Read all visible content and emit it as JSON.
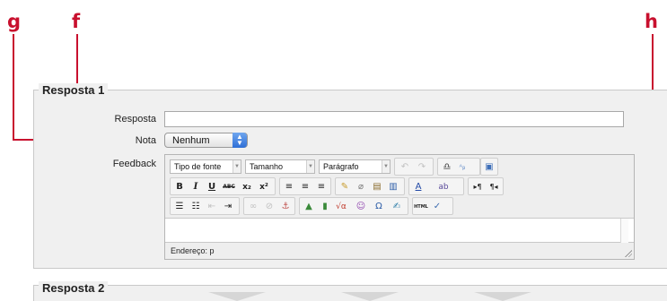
{
  "callouts": {
    "g": "g",
    "f": "f",
    "h": "h"
  },
  "accent_color": "#c8102e",
  "section1": {
    "legend": "Resposta 1",
    "resposta_label": "Resposta",
    "resposta_value": "",
    "nota_label": "Nota",
    "nota_value": "Nenhum",
    "feedback_label": "Feedback"
  },
  "editor": {
    "font_family_select": "Tipo de fonte",
    "font_size_select": "Tamanho",
    "paragraph_select": "Parágrafo",
    "status_path": "Endereço: p",
    "row1_icons": [
      "undo-icon",
      "redo-icon",
      "find-icon",
      "replace-icon",
      "fullscreen-icon"
    ],
    "row2_icons": [
      "bold-icon",
      "italic-icon",
      "underline-icon",
      "strikethrough-icon",
      "subscript-icon",
      "superscript-icon",
      "align-left-icon",
      "align-center-icon",
      "align-right-icon",
      "cleanup-icon",
      "remove-format-icon",
      "paste-text-icon",
      "paste-word-icon",
      "text-color-icon",
      "background-color-icon",
      "ltr-icon",
      "rtl-icon"
    ],
    "row3_icons": [
      "unordered-list-icon",
      "ordered-list-icon",
      "outdent-icon",
      "indent-icon",
      "link-icon",
      "unlink-icon",
      "anchor-icon",
      "image-icon",
      "media-icon",
      "equation-icon",
      "emoticon-icon",
      "special-char-icon",
      "edit-icon",
      "html-icon",
      "spellcheck-icon"
    ],
    "bold_glyph": "B",
    "italic_glyph": "I",
    "underline_glyph": "U",
    "strike_glyph": "ABC",
    "sub_glyph": "x₂",
    "sup_glyph": "x²",
    "html_glyph": "HTML"
  },
  "section2": {
    "legend": "Resposta 2"
  }
}
